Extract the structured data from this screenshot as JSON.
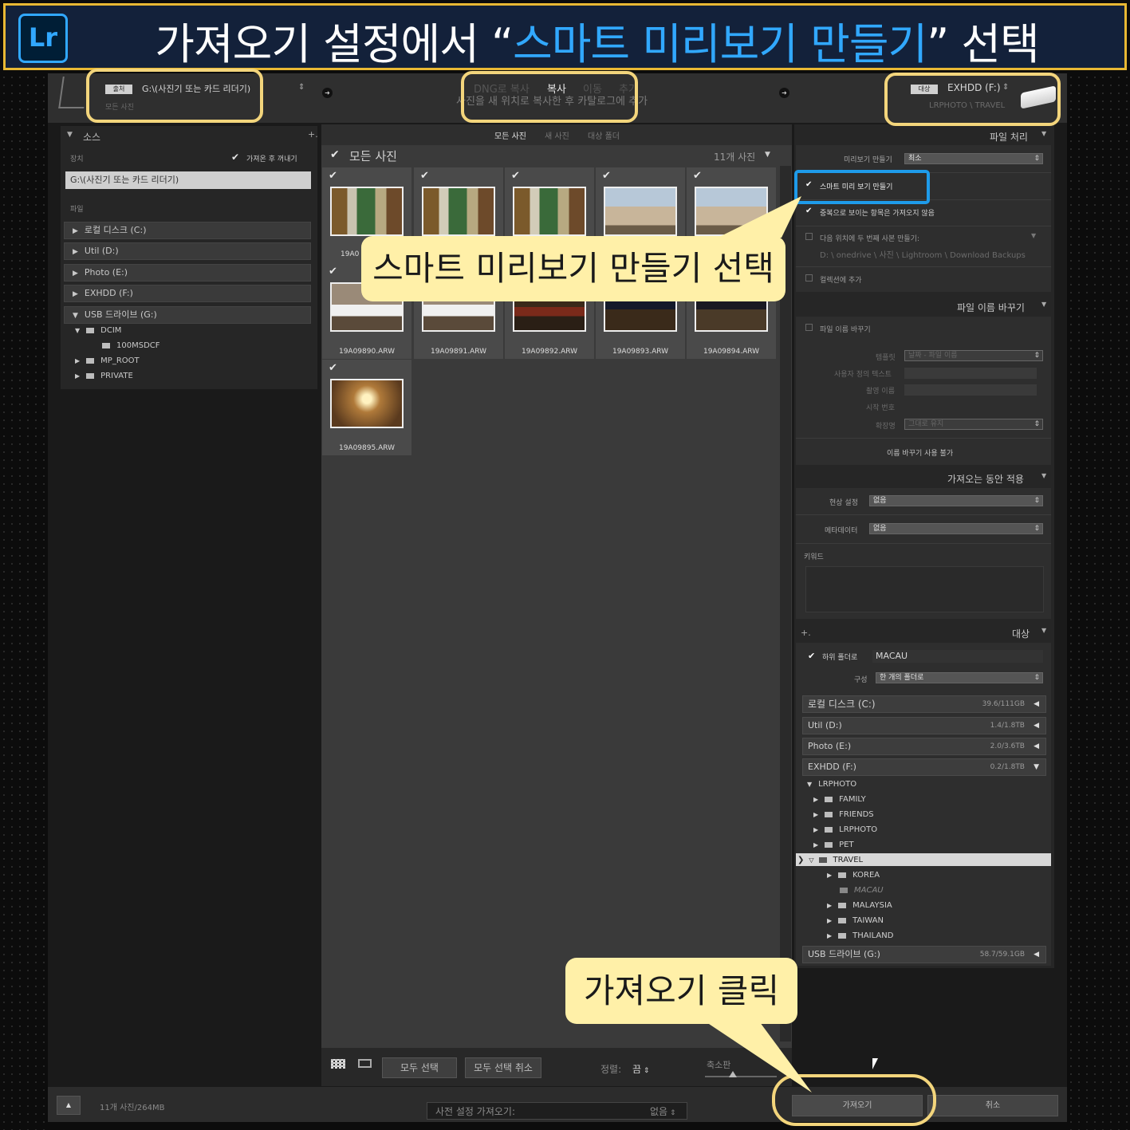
{
  "banner": {
    "logo": "Lr",
    "title_pre": "가져오기 설정에서 “",
    "title_highlight": "스마트 미리보기 만들기",
    "title_post": "” 선택"
  },
  "top": {
    "source_badge": "출처",
    "source_path": "G:\\(사진기 또는 카드 리더기)",
    "source_sub": "모든 사진",
    "modes": [
      "DNG로 복사",
      "복사",
      "이동",
      "추가"
    ],
    "mode_desc": "사진을 새 위치로 복사한 후 카탈로그에 추가",
    "dest_badge": "대상",
    "dest_drive": "EXHDD (F:)",
    "dest_path": "LRPHOTO \\ TRAVEL"
  },
  "source_panel": {
    "title": "소스",
    "device_label": "장치",
    "eject_label": "가져온 후 꺼내기",
    "device_value": "G:\\(사진기 또는 카드 리더기)",
    "files_label": "파일",
    "drives": [
      "로컬 디스크 (C:)",
      "Util (D:)",
      "Photo (E:)",
      "EXHDD (F:)",
      "USB 드라이브 (G:)"
    ],
    "tree": [
      "DCIM",
      "100MSDCF",
      "MP_ROOT",
      "PRIVATE"
    ]
  },
  "grid": {
    "tabs": [
      "모든 사진",
      "새 사진",
      "대상 폴더"
    ],
    "header": "모든 사진",
    "count": "11개 사진",
    "row1_partial": "19A0",
    "names": [
      "19A09890.ARW",
      "19A09891.ARW",
      "19A09892.ARW",
      "19A09893.ARW",
      "19A09894.ARW",
      "19A09895.ARW"
    ]
  },
  "right": {
    "file_handling_title": "파일 처리",
    "preview_label": "미리보기 만들기",
    "preview_value": "최소",
    "smart_preview": "스마트 미리 보기 만들기",
    "no_duplicates": "중복으로 보이는 항목은 가져오지 않음",
    "second_copy": "다음 위치에 두 번째 사본 만들기:",
    "second_copy_path": "D: \\ onedrive \\ 사진 \\ Lightroom \\ Download Backups",
    "add_collection": "컬렉션에 추가",
    "rename_title": "파일 이름 바꾸기",
    "rename_check": "파일 이름 바꾸기",
    "template_label": "템플릿",
    "template_value": "날짜 - 파일 이름",
    "custom_text": "사용자 정의 텍스트",
    "shoot_name": "촬영 이름",
    "start_number": "시작 번호",
    "extension_label": "확장명",
    "extension_value": "그대로 유지",
    "rename_disabled": "이름 바꾸기 사용 불가",
    "apply_title": "가져오는 동안 적용",
    "develop_label": "현상 설정",
    "develop_value": "없음",
    "metadata_label": "메타데이터",
    "metadata_value": "없음",
    "keywords_label": "키워드",
    "dest_title": "대상",
    "dest_plus": "+.",
    "subfolder_label": "하위 폴더로",
    "subfolder_value": "MACAU",
    "organize_label": "구성",
    "organize_value": "한 개의 폴더로",
    "drives": [
      {
        "name": "로컬 디스크 (C:)",
        "cap": "39.6/111GB",
        "arrow": "◀"
      },
      {
        "name": "Util (D:)",
        "cap": "1.4/1.8TB",
        "arrow": "◀"
      },
      {
        "name": "Photo (E:)",
        "cap": "2.0/3.6TB",
        "arrow": "◀"
      },
      {
        "name": "EXHDD (F:)",
        "cap": "0.2/1.8TB",
        "arrow": "▼"
      }
    ],
    "tree_root": "LRPHOTO",
    "tree": [
      "FAMILY",
      "FRIENDS",
      "LRPHOTO",
      "PET",
      "TRAVEL",
      "KOREA",
      "MACAU",
      "MALAYSIA",
      "TAIWAN",
      "THAILAND"
    ],
    "usb_drive": {
      "name": "USB 드라이브 (G:)",
      "cap": "58.7/59.1GB",
      "arrow": "◀"
    }
  },
  "toolbar": {
    "select_all": "모두 선택",
    "deselect_all": "모두 선택 취소",
    "sort_label": "정렬:",
    "sort_value": "끔",
    "thumb_label": "축소판"
  },
  "bottom": {
    "count": "11개 사진/264MB",
    "preset_label": "사전 설정 가져오기:",
    "preset_value": "없음",
    "import": "가져오기",
    "cancel": "취소"
  },
  "callouts": {
    "smart": "스마트 미리보기 만들기 선택",
    "import": "가져오기 클릭"
  },
  "colors": {
    "banner_bg": "#13213a",
    "banner_border": "#e9b934",
    "accent_blue": "#31a8ff",
    "callout_bg": "#fff0a8",
    "highlight_border": "#f3d57c",
    "selection_border": "#1e9bea"
  }
}
